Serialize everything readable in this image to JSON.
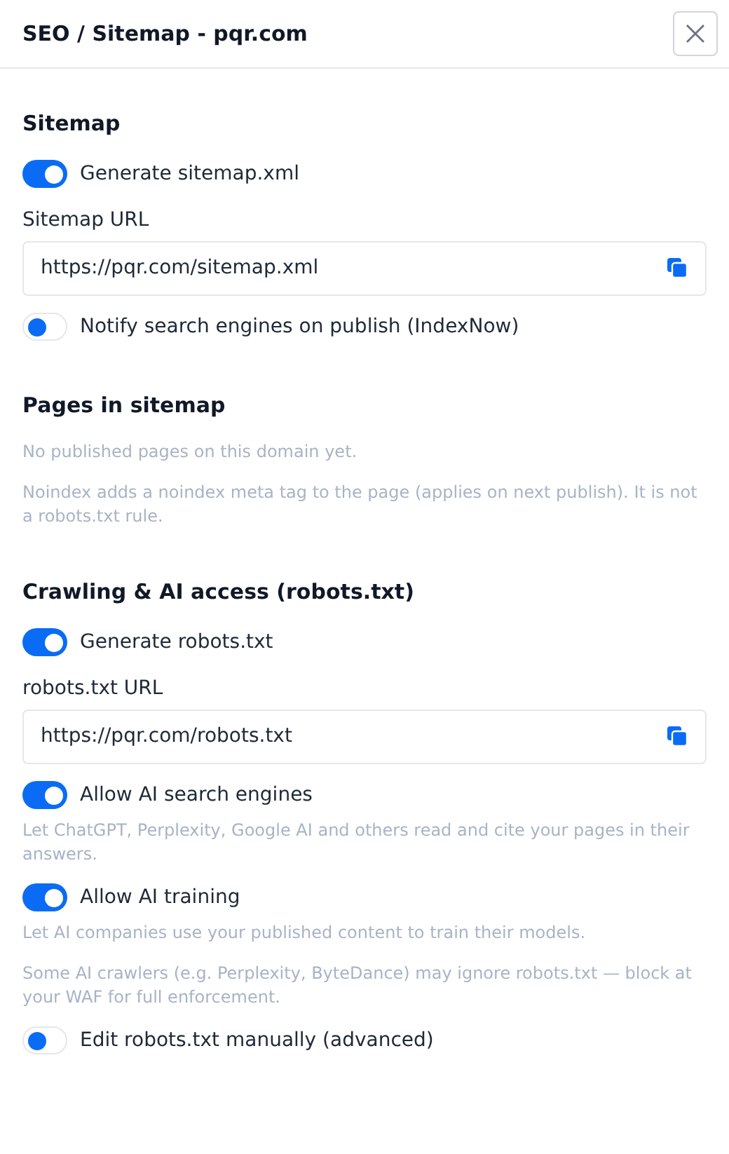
{
  "dialog": {
    "title": "SEO / Sitemap - pqr.com"
  },
  "sections": [
    {
      "heading": "Sitemap",
      "items": [
        {
          "kind": "toggle",
          "label": "Generate sitemap.xml",
          "on": true
        },
        {
          "kind": "url_field",
          "label": "Sitemap URL",
          "value": "https://pqr.com/sitemap.xml"
        },
        {
          "kind": "toggle",
          "label": "Notify search engines on publish (IndexNow)",
          "on": false
        }
      ]
    },
    {
      "heading": "Pages in sitemap",
      "items": [
        {
          "kind": "note",
          "text": "No published pages on this domain yet."
        },
        {
          "kind": "note",
          "text": "Noindex adds a noindex meta tag to the page (applies on next publish). It is not a robots.txt rule."
        }
      ]
    },
    {
      "heading": "Crawling & AI access (robots.txt)",
      "items": [
        {
          "kind": "toggle",
          "label": "Generate robots.txt",
          "on": true
        },
        {
          "kind": "url_field",
          "label": "robots.txt URL",
          "value": "https://pqr.com/robots.txt"
        },
        {
          "kind": "toggle",
          "label": "Allow AI search engines",
          "on": true,
          "description": "Let ChatGPT, Perplexity, Google AI and others read and cite your pages in their answers."
        },
        {
          "kind": "toggle",
          "label": "Allow AI training",
          "on": true,
          "description": "Let AI companies use your published content to train their models."
        },
        {
          "kind": "note",
          "text": "Some AI crawlers (e.g. Perplexity, ByteDance) may ignore robots.txt — block at your WAF for full enforcement."
        },
        {
          "kind": "toggle",
          "label": "Edit robots.txt manually (advanced)",
          "on": false
        }
      ]
    }
  ]
}
